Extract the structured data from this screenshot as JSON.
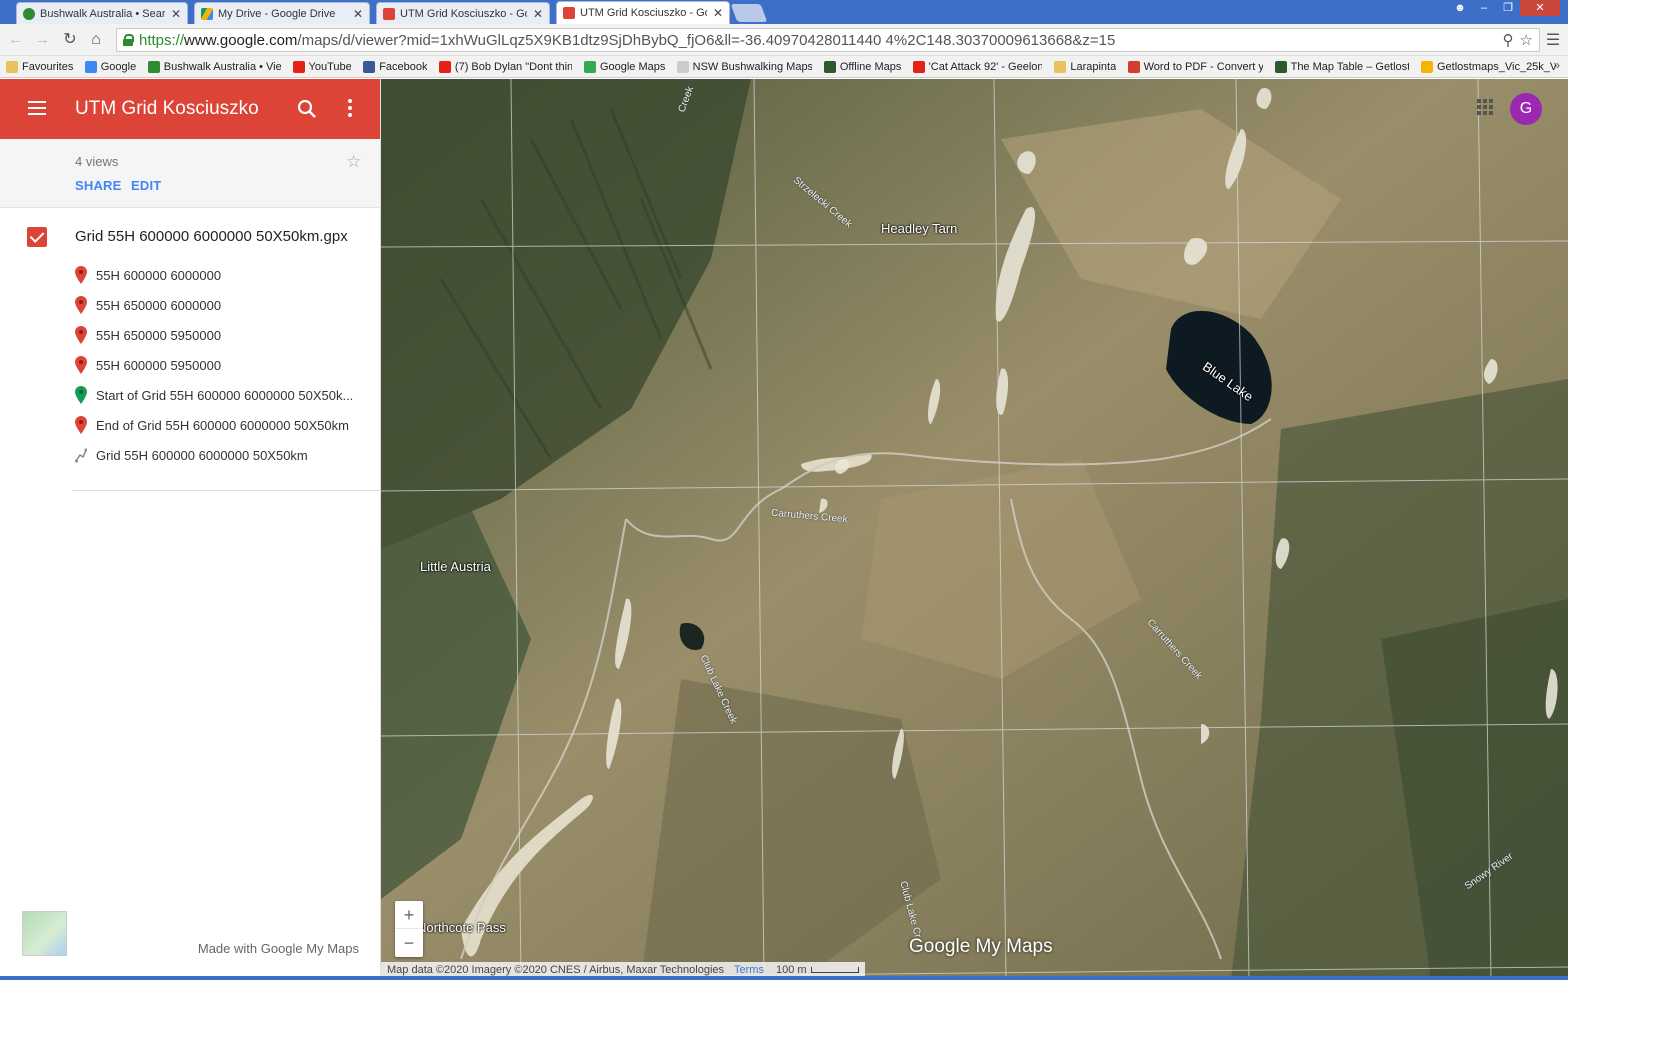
{
  "browser": {
    "tabs": [
      {
        "title": "Bushwalk Australia • Search",
        "icon_color": "#2e8b2e"
      },
      {
        "title": "My Drive - Google Drive",
        "icon_color": "#f4b400"
      },
      {
        "title": "UTM Grid Kosciuszko - Google",
        "icon_color": "#db4437"
      },
      {
        "title": "UTM Grid Kosciuszko - Google",
        "icon_color": "#db4437",
        "active": true
      }
    ],
    "url_scheme": "https://",
    "url_host": "www.google.com",
    "url_rest": "/maps/d/viewer?mid=1xhWuGlLqz5X9KB1dtz9SjDhBybQ_fjO6&ll=-36.40970428011440 4%2C148.30370009613668&z=15",
    "bookmarks": [
      {
        "label": "Favourites",
        "icon": "folder-icon",
        "color": "#e8c25a"
      },
      {
        "label": "Google",
        "icon": "google-icon",
        "color": "#4285f4"
      },
      {
        "label": "Bushwalk Australia • Vie",
        "icon": "bushwalk-icon",
        "color": "#2e8b2e"
      },
      {
        "label": "YouTube",
        "icon": "youtube-icon",
        "color": "#e62117"
      },
      {
        "label": "Facebook",
        "icon": "facebook-icon",
        "color": "#3b5998"
      },
      {
        "label": "(7) Bob Dylan \"Dont thin",
        "icon": "youtube-icon",
        "color": "#e62117"
      },
      {
        "label": "Google Maps",
        "icon": "maps-pin-icon",
        "color": "#34a853"
      },
      {
        "label": "NSW Bushwalking Maps",
        "icon": "page-icon",
        "color": "#cccccc"
      },
      {
        "label": "Offline Maps",
        "icon": "offline-maps-icon",
        "color": "#2d5a2d"
      },
      {
        "label": "'Cat Attack 92' - Geelon",
        "icon": "youtube-icon",
        "color": "#e62117"
      },
      {
        "label": "Larapinta",
        "icon": "folder-icon",
        "color": "#e8c25a"
      },
      {
        "label": "Word to PDF - Convert y",
        "icon": "word-pdf-icon",
        "color": "#d63b2f"
      },
      {
        "label": "The Map Table – Getlost",
        "icon": "maptable-icon",
        "color": "#2d5a2d"
      },
      {
        "label": "Getlostmaps_Vic_25k_V",
        "icon": "drive-icon",
        "color": "#f4b400"
      }
    ]
  },
  "sidebar": {
    "title": "UTM Grid Kosciuszko",
    "views": "4 views",
    "share_label": "SHARE",
    "edit_label": "EDIT",
    "layer_title": "Grid 55H 600000 6000000 50X50km.gpx",
    "items": [
      {
        "label": "55H 600000 6000000",
        "icon": "red-pin-icon"
      },
      {
        "label": "55H 650000 6000000",
        "icon": "red-pin-icon"
      },
      {
        "label": "55H 650000 5950000",
        "icon": "red-pin-icon"
      },
      {
        "label": "55H 600000 5950000",
        "icon": "red-pin-icon"
      },
      {
        "label": "Start of Grid 55H 600000 6000000 50X50k...",
        "icon": "green-pin-icon"
      },
      {
        "label": "End of Grid 55H 600000 6000000 50X50km",
        "icon": "red-pin-icon"
      },
      {
        "label": "Grid 55H 600000 6000000 50X50km",
        "icon": "line-path-icon"
      }
    ],
    "footer_text": "Made with Google My Maps",
    "colors": {
      "header": "#db4437",
      "link": "#4285f4"
    }
  },
  "map": {
    "places": {
      "headley_tarn": "Headley Tarn",
      "blue_lake": "Blue Lake",
      "little_austria": "Little Austria",
      "northcote_pass": "Northcote Pass"
    },
    "creeks": {
      "carruthers_1": "Carruthers Creek",
      "carruthers_2": "Carruthers Creek",
      "club_lake_1": "Club Lake Creek",
      "club_lake_2": "Club Lake Cr",
      "snowy_river": "Snowy River",
      "top_creek": "Creek",
      "headley_creek": "Strzelecki Creek"
    },
    "avatar_letter": "G",
    "zoom_in": "+",
    "zoom_out": "−",
    "logo_text": "Google My Maps",
    "attribution": "Map data ©2020 Imagery ©2020 CNES / Airbus, Maxar Technologies",
    "terms": "Terms",
    "scale_label": "100 m"
  }
}
